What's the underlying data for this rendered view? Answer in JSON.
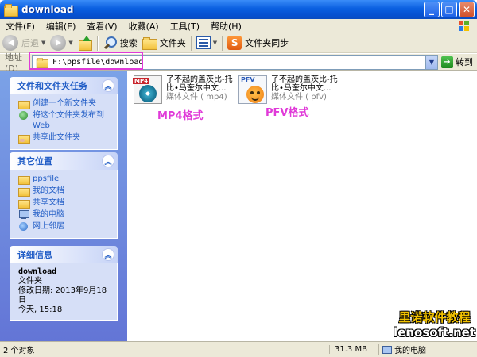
{
  "window": {
    "title": "download"
  },
  "menu": [
    "文件(F)",
    "编辑(E)",
    "查看(V)",
    "收藏(A)",
    "工具(T)",
    "帮助(H)"
  ],
  "toolbar": {
    "back": "后退",
    "search": "搜索",
    "folders": "文件夹",
    "sync": "文件夹同步"
  },
  "address": {
    "label": "地址(D)",
    "value": "F:\\ppsfile\\download",
    "go": "转到"
  },
  "tasks_panel": {
    "title": "文件和文件夹任务",
    "items": [
      "创建一个新文件夹",
      "将这个文件夹发布到 Web",
      "共享此文件夹"
    ]
  },
  "places_panel": {
    "title": "其它位置",
    "items": [
      "ppsfile",
      "我的文档",
      "共享文档",
      "我的电脑",
      "网上邻居"
    ]
  },
  "details_panel": {
    "title": "详细信息",
    "name": "download",
    "type": "文件夹",
    "modified_line1": "修改日期: 2013年9月18日",
    "modified_line2": "今天, 15:18"
  },
  "files": [
    {
      "icon": "mp4-file-icon",
      "tag": "MP4",
      "name_line1": "了不起的盖茨比-托",
      "name_line2": "比•马奎尔中文...",
      "type": "媒体文件 ( mp4)",
      "caption": "MP4格式"
    },
    {
      "icon": "pfv-file-icon",
      "tag": "PFV",
      "name_line1": "了不起的盖茨比-托",
      "name_line2": "比•马奎尔中文...",
      "type": "媒体文件 ( pfv)",
      "caption": "PFV格式"
    }
  ],
  "status": {
    "count": "2 个对象",
    "size": "31.3 MB",
    "location": "我的电脑"
  },
  "watermark": {
    "line1": "里诺软件教程",
    "line2": "lenosoft.net"
  },
  "colors": {
    "highlight": "#e03ad8",
    "titlebar": "#0a5fe0",
    "panel_link": "#215dc6"
  }
}
